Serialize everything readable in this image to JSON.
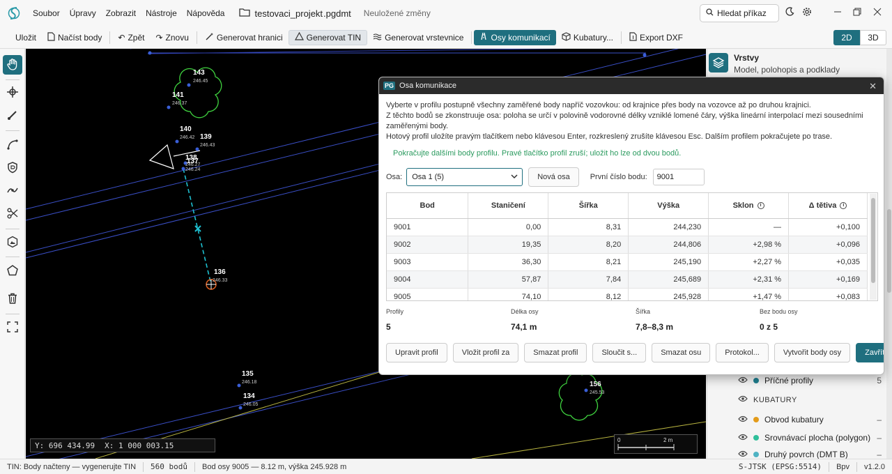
{
  "app": {
    "menu": [
      "Soubor",
      "Úpravy",
      "Zobrazit",
      "Nástroje",
      "Nápověda"
    ],
    "file_name": "testovaci_projekt",
    "file_ext": ".pgdmt",
    "unsaved": "Neuložené změny",
    "search_label": "Hledat příkaz"
  },
  "toolbar": {
    "save": "Uložit",
    "load_points": "Načíst body",
    "undo": "Zpět",
    "redo": "Znovu",
    "gen_boundary": "Generovat hranici",
    "gen_tin": "Generovat TIN",
    "gen_contours": "Generovat vrstevnice",
    "road_axes": "Osy komunikací",
    "volumes": "Kubatury...",
    "export_dxf": "Export DXF",
    "view_2d": "2D",
    "view_3d": "3D"
  },
  "canvas": {
    "points": [
      {
        "num": "143",
        "h": "246.45"
      },
      {
        "num": "141",
        "h": "246.37"
      },
      {
        "num": "140",
        "h": "246.42"
      },
      {
        "num": "139",
        "h": "246.43"
      },
      {
        "num": "138",
        "h": "246.27"
      },
      {
        "num": "137",
        "h": "246.24"
      },
      {
        "num": "136",
        "h": "246.33"
      },
      {
        "num": "135",
        "h": "246.18"
      },
      {
        "num": "134",
        "h": "246.05"
      },
      {
        "num": "156",
        "h": "245.53"
      }
    ],
    "coord_y": "Y:   696 434.99",
    "coord_x": "X: 1 000 003.15",
    "scale_zero": "0",
    "scale_unit": "2 m"
  },
  "layers": {
    "title": "Vrstvy",
    "subtitle": "Model, polohopis a podklady",
    "rows": [
      {
        "label": "Příčné profily",
        "count": "5",
        "color": "#1f7f8f"
      }
    ],
    "section": "KUBATURY",
    "kub_rows": [
      {
        "label": "Obvod kubatury",
        "count": "–",
        "color": "#e39b1a"
      },
      {
        "label": "Srovnávací plocha (polygon)",
        "count": "–",
        "color": "#2fbf9a"
      },
      {
        "label": "Druhý povrch (DMT B)",
        "count": "–",
        "color": "#4fb3c3"
      }
    ]
  },
  "status": {
    "tin": "TIN: Body načteny — vygenerujte TIN",
    "points": "560 bodů",
    "axis_point": "Bod osy 9005 — 8.12 m, výška 245.928 m",
    "crs": "S-JTSK (EPSG:5514)",
    "height_system": "Bpv",
    "version": "v1.2.0"
  },
  "dialog": {
    "badge": "PG",
    "title": "Osa komunikace",
    "p1": "Vyberte v profilu postupně všechny zaměřené body napříč vozovkou: od krajnice přes body na vozovce až po druhou krajnici.",
    "p2": "Z těchto bodů se zkonstruuje osa: poloha se určí v polovině vodorovné délky vzniklé lomené čáry, výška lineární interpolací mezi sousedními zaměřenými body.",
    "p3": "Hotový profil uložíte pravým tlačítkem nebo klávesou Enter, rozkreslený zrušíte klávesou Esc. Dalším profilem pokračujete po trase.",
    "hint": "Pokračujte dalšími body profilu. Pravé tlačítko profil zruší; uložit ho lze od dvou bodů.",
    "axis_label": "Osa:",
    "axis_value": "Osa 1 (5)",
    "new_axis": "Nová osa",
    "first_point_label": "První číslo bodu:",
    "first_point_value": "9001",
    "columns": [
      "Bod",
      "Staničení",
      "Šířka",
      "Výška",
      "Sklon",
      "Δ tětiva"
    ],
    "rows": [
      [
        "9001",
        "0,00",
        "8,31",
        "244,230",
        "—",
        "+0,100"
      ],
      [
        "9002",
        "19,35",
        "8,20",
        "244,806",
        "+2,98 %",
        "+0,096"
      ],
      [
        "9003",
        "36,30",
        "8,21",
        "245,190",
        "+2,27 %",
        "+0,035"
      ],
      [
        "9004",
        "57,87",
        "7,84",
        "245,689",
        "+2,31 %",
        "+0,169"
      ],
      [
        "9005",
        "74,10",
        "8,12",
        "245,928",
        "+1,47 %",
        "+0,083"
      ]
    ],
    "stats": [
      {
        "label": "Profily",
        "value": "5"
      },
      {
        "label": "Délka osy",
        "value": "74,1 m"
      },
      {
        "label": "Šířka",
        "value": "7,8–8,3 m"
      },
      {
        "label": "Bez bodu osy",
        "value": "0 z 5"
      }
    ],
    "buttons": [
      "Upravit profil",
      "Vložit profil za",
      "Smazat profil",
      "Sloučit s...",
      "Smazat osu",
      "Protokol...",
      "Vytvořit body osy",
      "Zavřít"
    ]
  }
}
